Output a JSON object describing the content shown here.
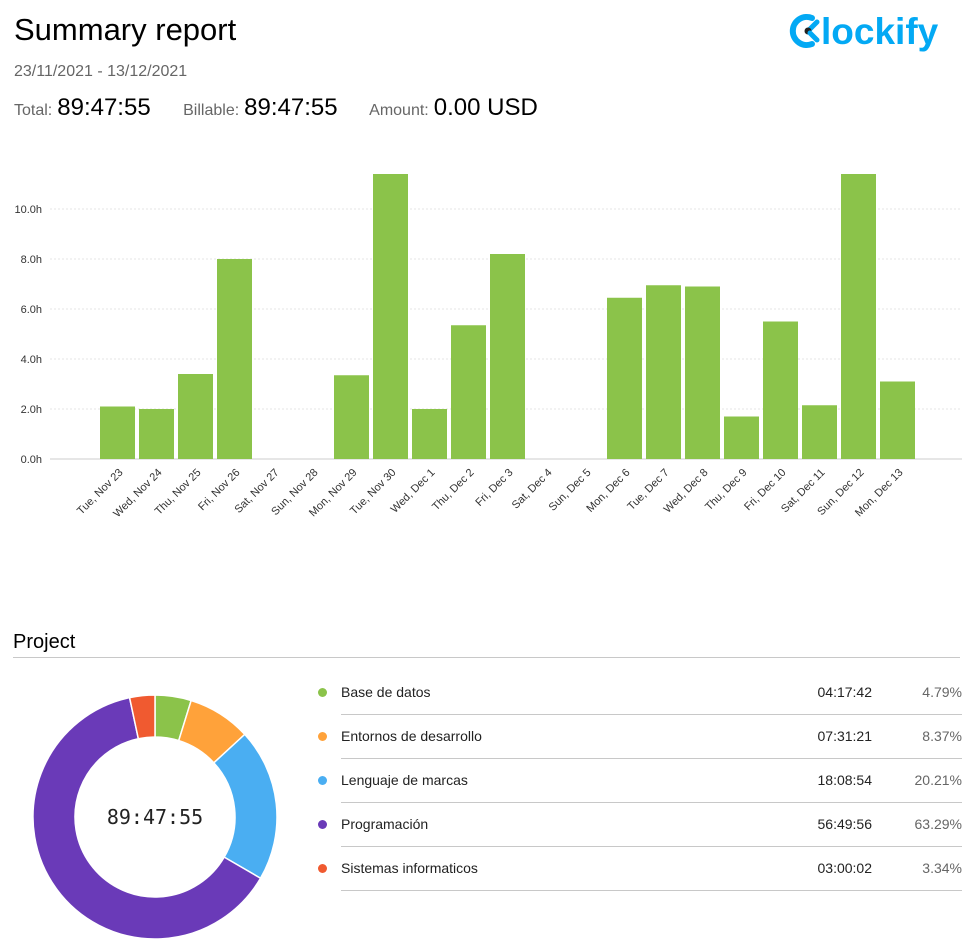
{
  "header": {
    "title": "Summary report",
    "date_range": "23/11/2021 - 13/12/2021",
    "total_label": "Total:",
    "total_value": "89:47:55",
    "billable_label": "Billable:",
    "billable_value": "89:47:55",
    "amount_label": "Amount:",
    "amount_value": "0.00 USD"
  },
  "logo": {
    "text": "lockify",
    "icon": "clockify-logo-icon",
    "color": "#03a9f4"
  },
  "chart_data": {
    "type": "bar",
    "categories": [
      "Tue, Nov 23",
      "Wed, Nov 24",
      "Thu, Nov 25",
      "Fri, Nov 26",
      "Sat, Nov 27",
      "Sun, Nov 28",
      "Mon, Nov 29",
      "Tue, Nov 30",
      "Wed, Dec 1",
      "Thu, Dec 2",
      "Fri, Dec 3",
      "Sat, Dec 4",
      "Sun, Dec 5",
      "Mon, Dec 6",
      "Tue, Dec 7",
      "Wed, Dec 8",
      "Thu, Dec 9",
      "Fri, Dec 10",
      "Sat, Dec 11",
      "Sun, Dec 12",
      "Mon, Dec 13"
    ],
    "values": [
      2.1,
      2.0,
      3.4,
      8.0,
      0,
      0,
      3.35,
      11.4,
      2.0,
      5.35,
      8.2,
      0,
      0,
      6.45,
      6.95,
      6.9,
      1.7,
      5.5,
      2.15,
      11.4,
      3.1
    ],
    "y_ticks": [
      "0.0h",
      "2.0h",
      "4.0h",
      "6.0h",
      "8.0h",
      "10.0h"
    ],
    "ylim": [
      0,
      12
    ],
    "grid": true,
    "bar_color": "#8bc34a",
    "title": "",
    "xlabel": "",
    "ylabel": ""
  },
  "project": {
    "section_title": "Project",
    "total": "89:47:55",
    "items": [
      {
        "name": "Base de datos",
        "duration": "04:17:42",
        "percent": "4.79%",
        "share": 4.79,
        "color": "#8bc34a"
      },
      {
        "name": "Entornos de desarrollo",
        "duration": "07:31:21",
        "percent": "8.37%",
        "share": 8.37,
        "color": "#ffa23a"
      },
      {
        "name": "Lenguaje de marcas",
        "duration": "18:08:54",
        "percent": "20.21%",
        "share": 20.21,
        "color": "#4aaef2"
      },
      {
        "name": "Programación",
        "duration": "56:49:56",
        "percent": "63.29%",
        "share": 63.29,
        "color": "#6a3ab8"
      },
      {
        "name": "Sistemas informaticos",
        "duration": "03:00:02",
        "percent": "3.34%",
        "share": 3.34,
        "color": "#f05a30"
      }
    ]
  }
}
